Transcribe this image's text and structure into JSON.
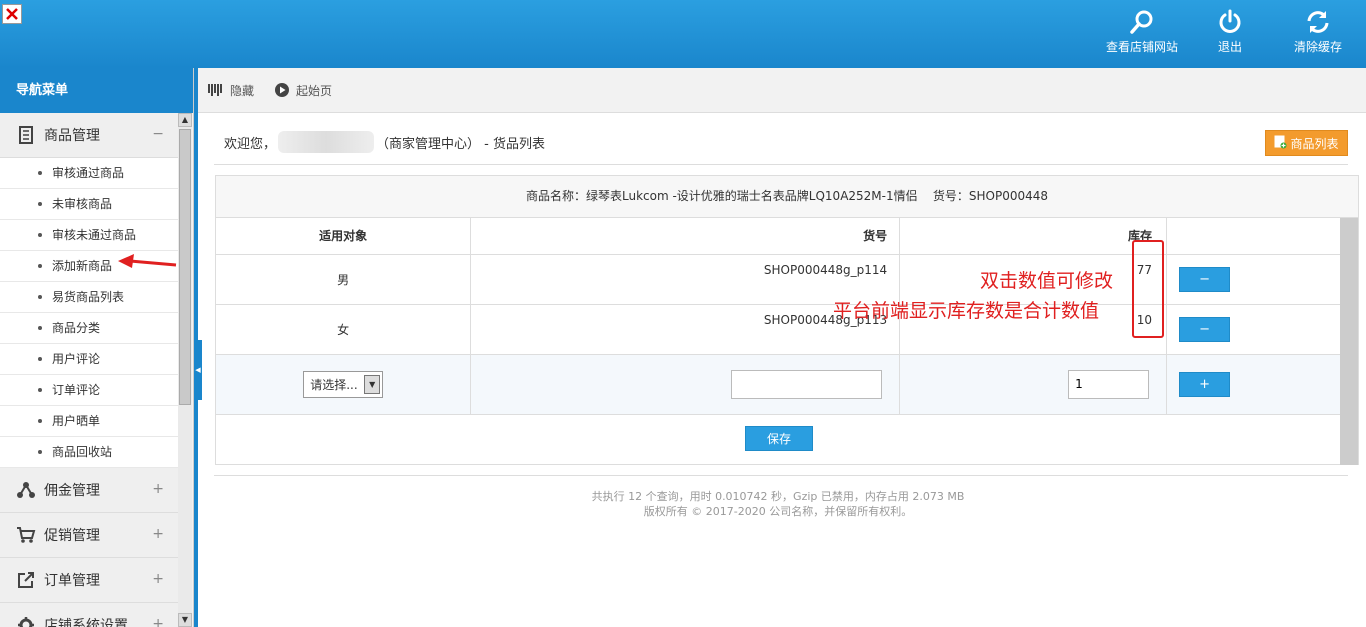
{
  "header": {
    "actions": [
      {
        "label": "查看店铺网站",
        "icon": "search-icon"
      },
      {
        "label": "退出",
        "icon": "power-icon"
      },
      {
        "label": "清除缓存",
        "icon": "refresh-icon"
      }
    ]
  },
  "sidebar": {
    "title": "导航菜单",
    "groups": [
      {
        "label": "商品管理",
        "toggle": "−",
        "icon": "doc-icon",
        "items": [
          "审核通过商品",
          "未审核商品",
          "审核未通过商品",
          "添加新商品",
          "易货商品列表",
          "商品分类",
          "用户评论",
          "订单评论",
          "用户晒单",
          "商品回收站"
        ]
      },
      {
        "label": "佣金管理",
        "toggle": "+",
        "icon": "share-icon"
      },
      {
        "label": "促销管理",
        "toggle": "+",
        "icon": "cart-icon"
      },
      {
        "label": "订单管理",
        "toggle": "+",
        "icon": "export-icon"
      },
      {
        "label": "店铺系统设置",
        "toggle": "+",
        "icon": "gear-icon"
      }
    ]
  },
  "toolbar": {
    "hide_label": "隐藏",
    "home_label": "起始页"
  },
  "main": {
    "welcome_prefix": "欢迎您，",
    "welcome_suffix": "（商家管理中心） - 货品列表",
    "list_button": "商品列表",
    "product_title": "商品名称：绿琴表Lukcom -设计优雅的瑞士名表品牌LQ10A252M-1情侣    货号：SHOP000448",
    "columns": [
      "适用对象",
      "货号",
      "库存",
      ""
    ],
    "rows": [
      {
        "target": "男",
        "sku": "SHOP000448g_p114",
        "stock": "77",
        "action": "−"
      },
      {
        "target": "女",
        "sku": "SHOP000448g_p113",
        "stock": "10",
        "action": "−"
      }
    ],
    "add_row": {
      "select_value": "请选择...",
      "sku_value": "",
      "qty_value": "1",
      "action": "+"
    },
    "save_label": "保存",
    "annotation_1": "双击数值可修改",
    "annotation_2": "平台前端显示库存数是合计数值"
  },
  "footer": {
    "line1": "共执行 12 个查询，用时 0.010742 秒，Gzip 已禁用，内存占用 2.073 MB",
    "line2": "版权所有 © 2017-2020 公司名称，并保留所有权利。"
  },
  "colors": {
    "primary": "#1a86cc",
    "accent": "#f39b2d",
    "annotation": "#e02020"
  }
}
